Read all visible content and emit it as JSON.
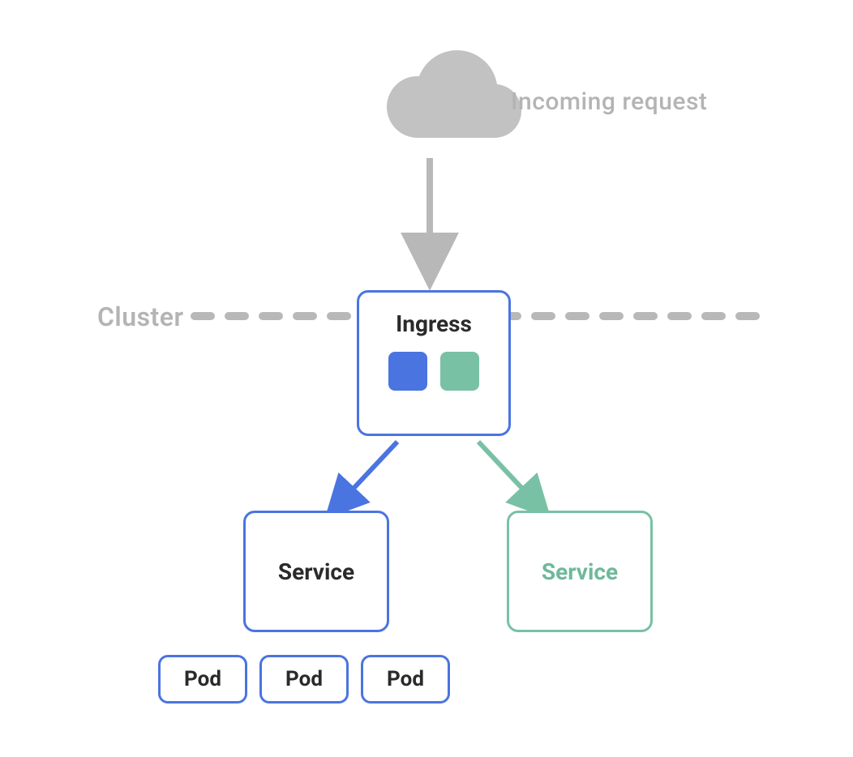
{
  "labels": {
    "incoming_request": "Incoming request",
    "cluster": "Cluster"
  },
  "ingress": {
    "title": "Ingress"
  },
  "services": {
    "left": {
      "title": "Service"
    },
    "right": {
      "title": "Service"
    }
  },
  "pods": [
    "Pod",
    "Pod",
    "Pod"
  ],
  "colors": {
    "blue": "#4a74e0",
    "green": "#79c1a4",
    "gray": "#b8b8b8"
  }
}
